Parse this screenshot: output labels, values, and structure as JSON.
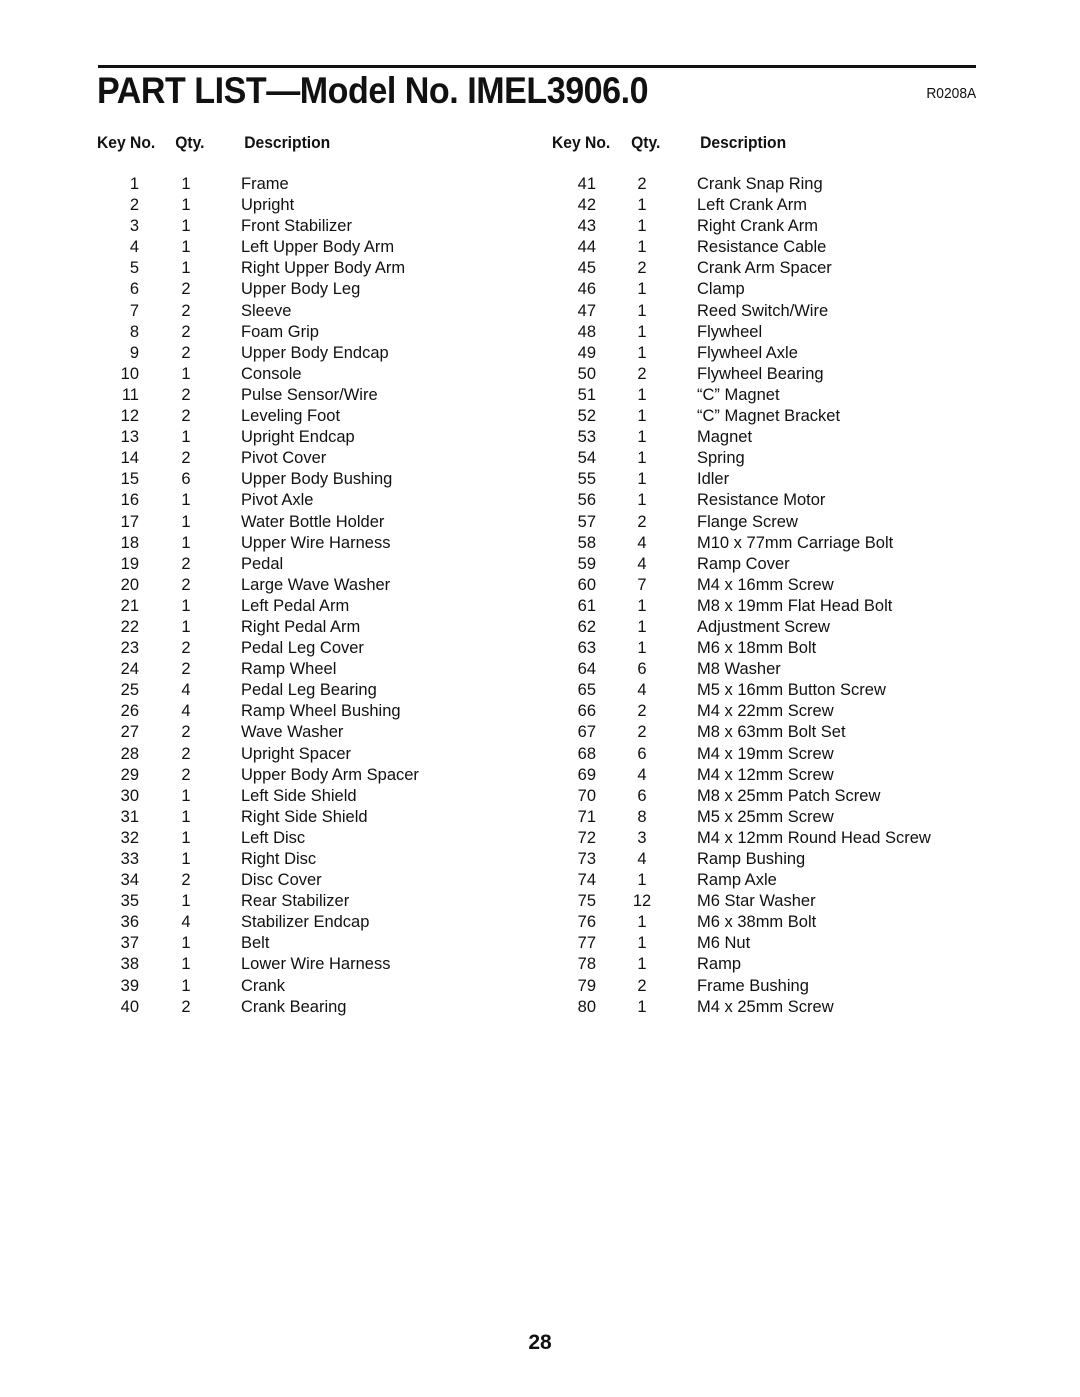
{
  "header": {
    "title": "PART LIST—Model No. IMEL3906.0",
    "code": "R0208A"
  },
  "columns": {
    "key_label": "Key No.",
    "qty_label": "Qty.",
    "desc_label": "Description"
  },
  "parts_left": [
    {
      "key": "1",
      "qty": "1",
      "desc": "Frame"
    },
    {
      "key": "2",
      "qty": "1",
      "desc": "Upright"
    },
    {
      "key": "3",
      "qty": "1",
      "desc": "Front Stabilizer"
    },
    {
      "key": "4",
      "qty": "1",
      "desc": "Left Upper Body Arm"
    },
    {
      "key": "5",
      "qty": "1",
      "desc": "Right Upper Body Arm"
    },
    {
      "key": "6",
      "qty": "2",
      "desc": "Upper Body Leg"
    },
    {
      "key": "7",
      "qty": "2",
      "desc": "Sleeve"
    },
    {
      "key": "8",
      "qty": "2",
      "desc": "Foam Grip"
    },
    {
      "key": "9",
      "qty": "2",
      "desc": "Upper Body Endcap"
    },
    {
      "key": "10",
      "qty": "1",
      "desc": "Console"
    },
    {
      "key": "11",
      "qty": "2",
      "desc": "Pulse Sensor/Wire"
    },
    {
      "key": "12",
      "qty": "2",
      "desc": "Leveling Foot"
    },
    {
      "key": "13",
      "qty": "1",
      "desc": "Upright Endcap"
    },
    {
      "key": "14",
      "qty": "2",
      "desc": "Pivot Cover"
    },
    {
      "key": "15",
      "qty": "6",
      "desc": "Upper Body Bushing"
    },
    {
      "key": "16",
      "qty": "1",
      "desc": "Pivot Axle"
    },
    {
      "key": "17",
      "qty": "1",
      "desc": "Water Bottle Holder"
    },
    {
      "key": "18",
      "qty": "1",
      "desc": "Upper Wire Harness"
    },
    {
      "key": "19",
      "qty": "2",
      "desc": "Pedal"
    },
    {
      "key": "20",
      "qty": "2",
      "desc": "Large Wave Washer"
    },
    {
      "key": "21",
      "qty": "1",
      "desc": "Left Pedal Arm"
    },
    {
      "key": "22",
      "qty": "1",
      "desc": "Right Pedal Arm"
    },
    {
      "key": "23",
      "qty": "2",
      "desc": "Pedal Leg Cover"
    },
    {
      "key": "24",
      "qty": "2",
      "desc": "Ramp Wheel"
    },
    {
      "key": "25",
      "qty": "4",
      "desc": "Pedal Leg Bearing"
    },
    {
      "key": "26",
      "qty": "4",
      "desc": "Ramp Wheel Bushing"
    },
    {
      "key": "27",
      "qty": "2",
      "desc": "Wave Washer"
    },
    {
      "key": "28",
      "qty": "2",
      "desc": "Upright Spacer"
    },
    {
      "key": "29",
      "qty": "2",
      "desc": "Upper Body Arm Spacer"
    },
    {
      "key": "30",
      "qty": "1",
      "desc": "Left Side Shield"
    },
    {
      "key": "31",
      "qty": "1",
      "desc": "Right Side Shield"
    },
    {
      "key": "32",
      "qty": "1",
      "desc": "Left Disc"
    },
    {
      "key": "33",
      "qty": "1",
      "desc": "Right Disc"
    },
    {
      "key": "34",
      "qty": "2",
      "desc": "Disc Cover"
    },
    {
      "key": "35",
      "qty": "1",
      "desc": "Rear Stabilizer"
    },
    {
      "key": "36",
      "qty": "4",
      "desc": "Stabilizer Endcap"
    },
    {
      "key": "37",
      "qty": "1",
      "desc": "Belt"
    },
    {
      "key": "38",
      "qty": "1",
      "desc": "Lower Wire Harness"
    },
    {
      "key": "39",
      "qty": "1",
      "desc": "Crank"
    },
    {
      "key": "40",
      "qty": "2",
      "desc": "Crank Bearing"
    }
  ],
  "parts_right": [
    {
      "key": "41",
      "qty": "2",
      "desc": "Crank Snap Ring"
    },
    {
      "key": "42",
      "qty": "1",
      "desc": "Left Crank Arm"
    },
    {
      "key": "43",
      "qty": "1",
      "desc": "Right Crank Arm"
    },
    {
      "key": "44",
      "qty": "1",
      "desc": "Resistance Cable"
    },
    {
      "key": "45",
      "qty": "2",
      "desc": "Crank Arm Spacer"
    },
    {
      "key": "46",
      "qty": "1",
      "desc": "Clamp"
    },
    {
      "key": "47",
      "qty": "1",
      "desc": "Reed Switch/Wire"
    },
    {
      "key": "48",
      "qty": "1",
      "desc": "Flywheel"
    },
    {
      "key": "49",
      "qty": "1",
      "desc": "Flywheel Axle"
    },
    {
      "key": "50",
      "qty": "2",
      "desc": "Flywheel Bearing"
    },
    {
      "key": "51",
      "qty": "1",
      "desc": "“C” Magnet"
    },
    {
      "key": "52",
      "qty": "1",
      "desc": "“C” Magnet Bracket"
    },
    {
      "key": "53",
      "qty": "1",
      "desc": "Magnet"
    },
    {
      "key": "54",
      "qty": "1",
      "desc": "Spring"
    },
    {
      "key": "55",
      "qty": "1",
      "desc": "Idler"
    },
    {
      "key": "56",
      "qty": "1",
      "desc": "Resistance Motor"
    },
    {
      "key": "57",
      "qty": "2",
      "desc": "Flange Screw"
    },
    {
      "key": "58",
      "qty": "4",
      "desc": "M10 x 77mm Carriage Bolt"
    },
    {
      "key": "59",
      "qty": "4",
      "desc": "Ramp Cover"
    },
    {
      "key": "60",
      "qty": "7",
      "desc": "M4 x 16mm Screw"
    },
    {
      "key": "61",
      "qty": "1",
      "desc": "M8 x 19mm Flat Head Bolt"
    },
    {
      "key": "62",
      "qty": "1",
      "desc": "Adjustment Screw"
    },
    {
      "key": "63",
      "qty": "1",
      "desc": "M6 x 18mm Bolt"
    },
    {
      "key": "64",
      "qty": "6",
      "desc": "M8 Washer"
    },
    {
      "key": "65",
      "qty": "4",
      "desc": "M5 x 16mm Button Screw"
    },
    {
      "key": "66",
      "qty": "2",
      "desc": "M4 x 22mm Screw"
    },
    {
      "key": "67",
      "qty": "2",
      "desc": "M8 x 63mm Bolt Set"
    },
    {
      "key": "68",
      "qty": "6",
      "desc": "M4 x 19mm Screw"
    },
    {
      "key": "69",
      "qty": "4",
      "desc": "M4 x 12mm Screw"
    },
    {
      "key": "70",
      "qty": "6",
      "desc": "M8 x 25mm Patch Screw"
    },
    {
      "key": "71",
      "qty": "8",
      "desc": "M5 x 25mm Screw"
    },
    {
      "key": "72",
      "qty": "3",
      "desc": "M4 x 12mm Round Head Screw"
    },
    {
      "key": "73",
      "qty": "4",
      "desc": "Ramp Bushing"
    },
    {
      "key": "74",
      "qty": "1",
      "desc": "Ramp Axle"
    },
    {
      "key": "75",
      "qty": "12",
      "desc": "M6 Star Washer"
    },
    {
      "key": "76",
      "qty": "1",
      "desc": "M6 x 38mm Bolt"
    },
    {
      "key": "77",
      "qty": "1",
      "desc": "M6 Nut"
    },
    {
      "key": "78",
      "qty": "1",
      "desc": "Ramp"
    },
    {
      "key": "79",
      "qty": "2",
      "desc": "Frame Bushing"
    },
    {
      "key": "80",
      "qty": "1",
      "desc": "M4 x 25mm Screw"
    }
  ],
  "footer": {
    "page_number": "28"
  }
}
